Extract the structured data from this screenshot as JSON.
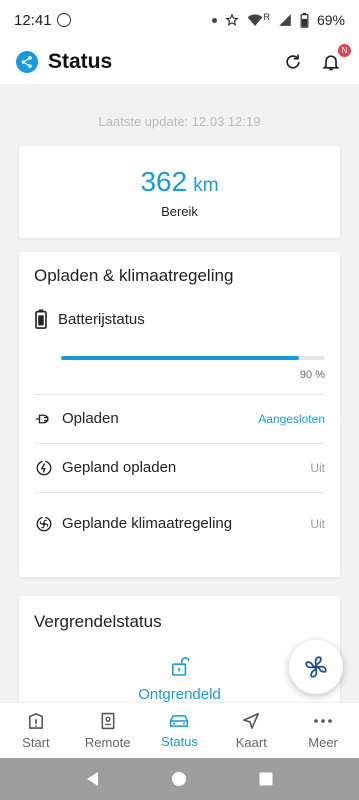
{
  "statusbar": {
    "time": "12:41",
    "battery": "69%",
    "roaming": "R"
  },
  "appbar": {
    "title": "Status",
    "notification_badge": "N"
  },
  "last_update": "Laatste update: 12.03 12:19",
  "range": {
    "value": "362",
    "unit": "km",
    "label": "Bereik"
  },
  "charging": {
    "title": "Opladen & klimaatregeling",
    "battery_label": "Batterijstatus",
    "battery_percent": 90,
    "battery_percent_text": "90 %",
    "rows": [
      {
        "label": "Opladen",
        "value": "Aangesloten"
      },
      {
        "label": "Gepland opladen",
        "value": "Uit"
      },
      {
        "label": "Geplande klimaatregeling",
        "value": "Uit"
      }
    ]
  },
  "lock": {
    "title": "Vergrendelstatus",
    "status": "Ontgrendeld"
  },
  "nav": [
    {
      "label": "Start",
      "icon": "start-icon"
    },
    {
      "label": "Remote",
      "icon": "remote-icon"
    },
    {
      "label": "Status",
      "icon": "car-icon",
      "active": true
    },
    {
      "label": "Kaart",
      "icon": "navigation-arrow-icon"
    },
    {
      "label": "Meer",
      "icon": "more-dots-icon"
    }
  ],
  "colors": {
    "accent": "#1a9bd7",
    "badge": "#e0454f"
  }
}
